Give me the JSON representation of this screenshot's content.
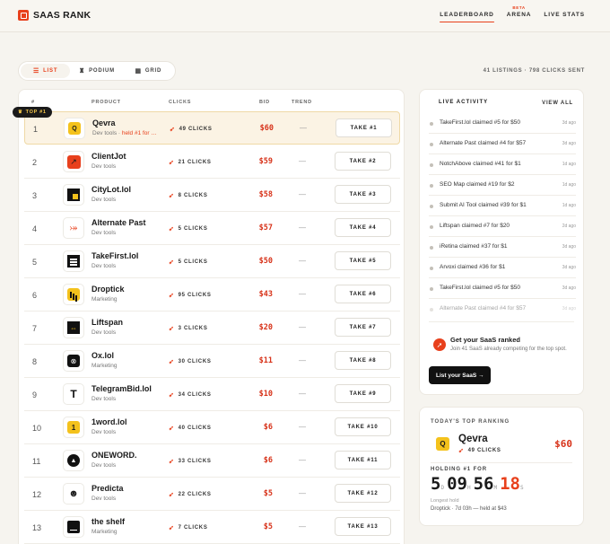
{
  "header": {
    "brand": "SAAS RANK",
    "nav": [
      {
        "label": "LEADERBOARD",
        "active": true
      },
      {
        "label": "ARENA",
        "badge": "BETA"
      },
      {
        "label": "LIVE STATS"
      }
    ]
  },
  "view_toggle": [
    {
      "label": "LIST",
      "icon": "list-icon",
      "active": true
    },
    {
      "label": "PODIUM",
      "icon": "trophy-icon"
    },
    {
      "label": "GRID",
      "icon": "grid-icon"
    }
  ],
  "summary": "41 LISTINGS · 798 CLICKS SENT",
  "table": {
    "headers": [
      "#",
      "PRODUCT",
      "CLICKS",
      "BID",
      "TREND"
    ],
    "top_badge": "TOP #1",
    "rows": [
      {
        "rank": "1",
        "name": "Qevra",
        "category": "Dev tools · ",
        "held": "held #1 for …",
        "clicks": "49 CLICKS",
        "bid": "$60",
        "trend": "—",
        "action": "TAKE #1"
      },
      {
        "rank": "2",
        "name": "ClientJot",
        "category": "Dev tools",
        "clicks": "21 CLICKS",
        "bid": "$59",
        "trend": "—",
        "action": "TAKE #2"
      },
      {
        "rank": "3",
        "name": "CityLot.lol",
        "category": "Dev tools",
        "clicks": "8 CLICKS",
        "bid": "$58",
        "trend": "—",
        "action": "TAKE #3"
      },
      {
        "rank": "4",
        "name": "Alternate Past",
        "category": "Dev tools",
        "clicks": "5 CLICKS",
        "bid": "$57",
        "trend": "—",
        "action": "TAKE #4"
      },
      {
        "rank": "5",
        "name": "TakeFirst.lol",
        "category": "Dev tools",
        "clicks": "5 CLICKS",
        "bid": "$50",
        "trend": "—",
        "action": "TAKE #5"
      },
      {
        "rank": "6",
        "name": "Droptick",
        "category": "Marketing",
        "clicks": "95 CLICKS",
        "bid": "$43",
        "trend": "—",
        "action": "TAKE #6"
      },
      {
        "rank": "7",
        "name": "Liftspan",
        "category": "Dev tools",
        "clicks": "3 CLICKS",
        "bid": "$20",
        "trend": "—",
        "action": "TAKE #7"
      },
      {
        "rank": "8",
        "name": "Ox.lol",
        "category": "Marketing",
        "clicks": "30 CLICKS",
        "bid": "$11",
        "trend": "—",
        "action": "TAKE #8"
      },
      {
        "rank": "9",
        "name": "TelegramBid.lol",
        "category": "Dev tools",
        "clicks": "34 CLICKS",
        "bid": "$10",
        "trend": "—",
        "action": "TAKE #9"
      },
      {
        "rank": "10",
        "name": "1word.lol",
        "category": "Dev tools",
        "clicks": "40 CLICKS",
        "bid": "$6",
        "trend": "—",
        "action": "TAKE #10"
      },
      {
        "rank": "11",
        "name": "ONEWORD.",
        "category": "Dev tools",
        "clicks": "33 CLICKS",
        "bid": "$6",
        "trend": "—",
        "action": "TAKE #11"
      },
      {
        "rank": "12",
        "name": "Predicta",
        "category": "Dev tools",
        "clicks": "22 CLICKS",
        "bid": "$5",
        "trend": "—",
        "action": "TAKE #12"
      },
      {
        "rank": "13",
        "name": "the shelf",
        "category": "Marketing",
        "clicks": "7 CLICKS",
        "bid": "$5",
        "trend": "—",
        "action": "TAKE #13"
      }
    ]
  },
  "live_activity": {
    "title": "LIVE ACTIVITY",
    "view_all": "VIEW ALL",
    "items": [
      {
        "text": "TakeFirst.lol claimed #5 for $50",
        "ago": "3d ago"
      },
      {
        "text": "Alternate Past claimed #4 for $57",
        "ago": "3d ago"
      },
      {
        "text": "NotchAbove claimed #41 for $1",
        "ago": "1d ago"
      },
      {
        "text": "SEO Map claimed #19 for $2",
        "ago": "1d ago"
      },
      {
        "text": "Submit AI Tool claimed #39 for $1",
        "ago": "1d ago"
      },
      {
        "text": "Liftspan claimed #7 for $20",
        "ago": "2d ago"
      },
      {
        "text": "iRetina claimed #37 for $1",
        "ago": "3d ago"
      },
      {
        "text": "Arvoxi claimed #36 for $1",
        "ago": "3d ago"
      },
      {
        "text": "TakeFirst.lol claimed #5 for $50",
        "ago": "3d ago"
      },
      {
        "text": "Alternate Past claimed #4 for $57",
        "ago": "3d ago"
      }
    ],
    "cta": {
      "title": "Get your SaaS ranked",
      "desc": "Join 41 SaaS already competing for the top spot.",
      "button": "List your SaaS →"
    }
  },
  "today_top": {
    "label": "TODAY'S TOP RANKING",
    "icon_letter": "Q",
    "name": "Qevra",
    "clicks": "49 CLICKS",
    "bid": "$60",
    "holding_label": "HOLDING #1 FOR",
    "timer": {
      "d": "5",
      "h": "09",
      "m": "56",
      "s": "18",
      "units": [
        "D",
        "H",
        "M",
        "S"
      ]
    },
    "longest_label": "Longest hold",
    "longest_value": "Droptick · 7d 03h — held at $43"
  },
  "colors": {
    "accent": "#e8401c",
    "gold": "#f4c21c",
    "bid": "#d73219"
  }
}
